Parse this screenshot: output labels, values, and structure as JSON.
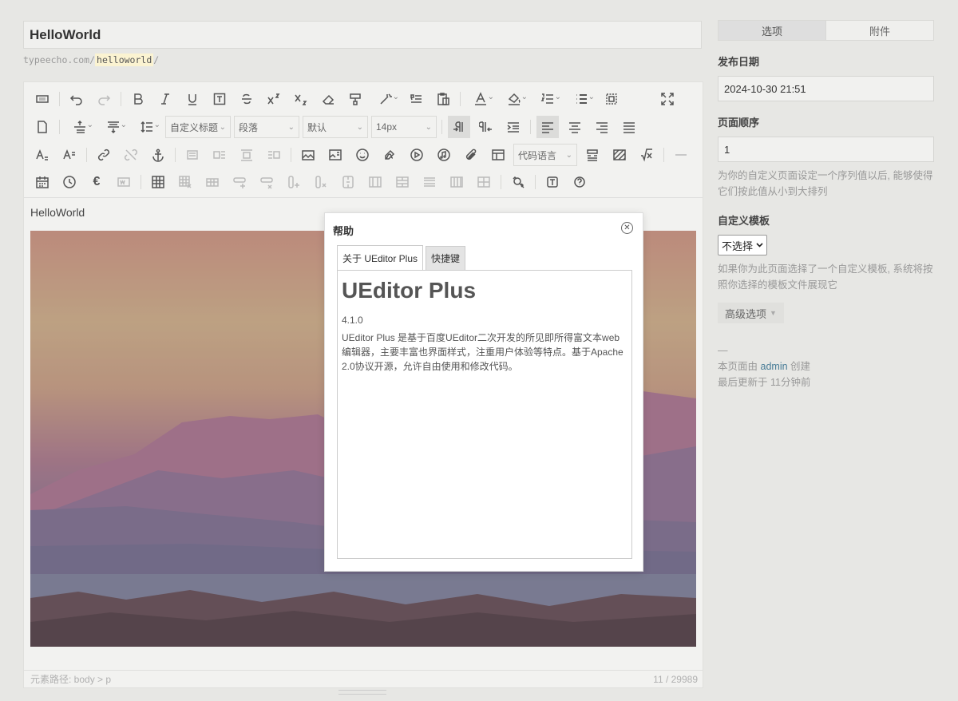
{
  "editor": {
    "title": "HelloWorld",
    "slug_prefix": "typeecho.com/",
    "slug_value": "helloworld",
    "slug_suffix": "/",
    "toolbar": {
      "custom_heading": "自定义标题",
      "paragraph": "段落",
      "font_family": "默认",
      "font_size": "14px",
      "code_language": "代码语言"
    },
    "content_text": "HelloWorld",
    "status_path": "元素路径: body > p",
    "word_count": "11 / 29989"
  },
  "sidebar": {
    "tabs": [
      "选项",
      "附件"
    ],
    "publish_date_label": "发布日期",
    "publish_date_value": "2024-10-30 21:51",
    "order_label": "页面顺序",
    "order_value": "1",
    "order_desc": "为你的自定义页面设定一个序列值以后, 能够使得它们按此值从小到大排列",
    "template_label": "自定义模板",
    "template_value": "不选择",
    "template_desc": "如果你为此页面选择了一个自定义模板, 系统将按照你选择的模板文件展现它",
    "advanced_label": "高级选项",
    "meta_dash": "—",
    "created_prefix": "本页面由",
    "author": "admin",
    "created_suffix": "创建",
    "updated": "最后更新于 11分钟前"
  },
  "dialog": {
    "title": "帮助",
    "tabs": [
      "关于 UEditor Plus",
      "快捷键"
    ],
    "heading": "UEditor Plus",
    "version": "4.1.0",
    "description": "UEditor Plus 是基于百度UEditor二次开发的所见即所得富文本web编辑器，主要丰富也界面样式，注重用户体验等特点。基于Apache 2.0协议开源，允许自由使用和修改代码。"
  }
}
